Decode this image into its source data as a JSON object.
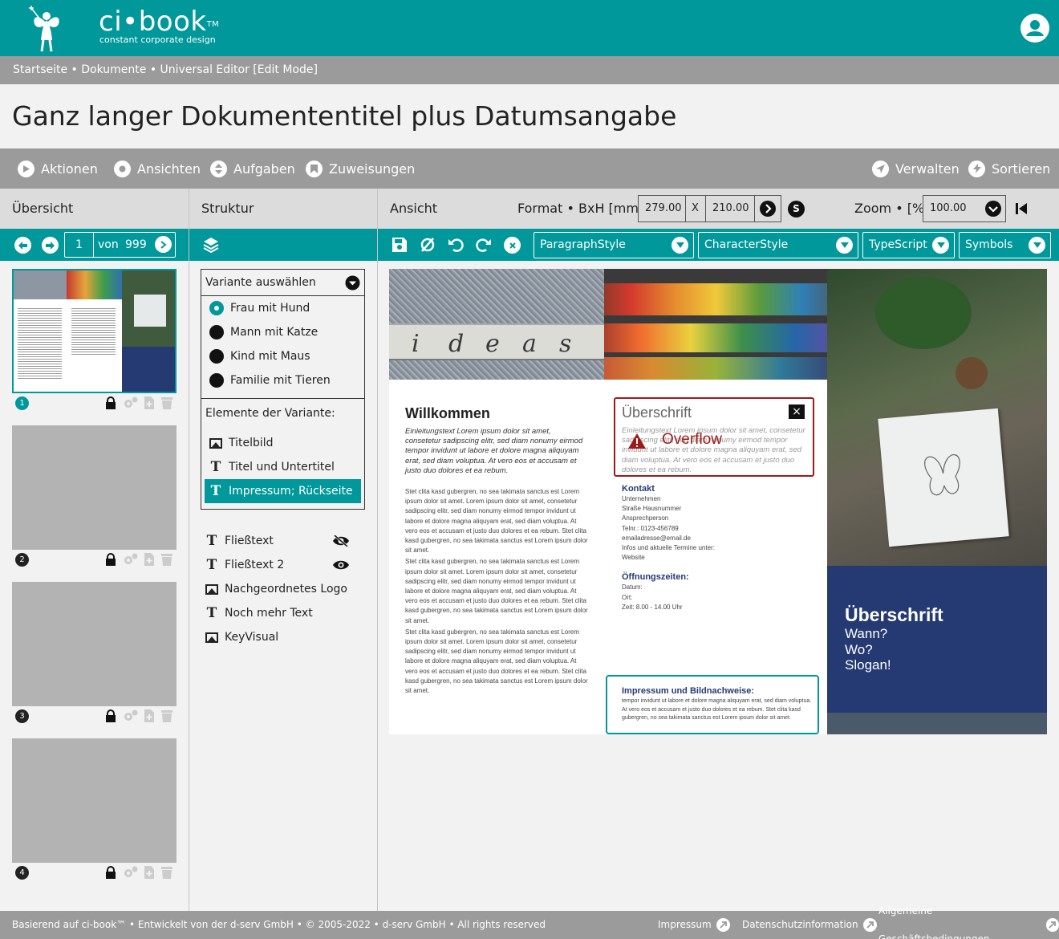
{
  "app": {
    "name": "ci•book",
    "trademark": "TM",
    "tagline": "constant corporate design"
  },
  "breadcrumb": "Startseite • Dokumente • Universal Editor [Edit Mode]",
  "document_title": "Ganz langer Dokumententitel plus Datumsangabe",
  "toolbar": {
    "left": [
      "Aktionen",
      "Ansichten",
      "Aufgaben",
      "Zuweisungen"
    ],
    "right": [
      "Verwalten",
      "Sortieren"
    ]
  },
  "columns": {
    "overview": "Übersicht",
    "structure": "Struktur",
    "view": "Ansicht"
  },
  "format": {
    "label": "Format • BxH [mm]",
    "width": "279.00",
    "separator": "X",
    "height": "210.00",
    "s_button": "S"
  },
  "zoom": {
    "label": "Zoom • [%]",
    "value": "100.00"
  },
  "pager": {
    "current": "1",
    "of_label": "von",
    "total": "999"
  },
  "pages": [
    {
      "number": "1"
    },
    {
      "number": "2"
    },
    {
      "number": "3"
    },
    {
      "number": "4"
    }
  ],
  "style_dropdowns": [
    "ParagraphStyle",
    "CharacterStyle",
    "TypeScript",
    "Symbols"
  ],
  "variants": {
    "select_label": "Variante auswählen",
    "options": [
      "Frau mit Hund",
      "Mann mit Katze",
      "Kind mit Maus",
      "Familie mit Tieren"
    ],
    "selected_index": 0,
    "elements_label": "Elemente der Variante:",
    "elements": [
      {
        "label": "Titelbild",
        "icon": "image-icon"
      },
      {
        "label": "Titel und Untertitel",
        "icon": "text-icon"
      },
      {
        "label": "Impressum; Rückseite",
        "icon": "text-icon"
      }
    ],
    "active_element_index": 2
  },
  "free_elements": [
    {
      "label": "Fließtext",
      "icon": "text-icon",
      "visibility": "eye-slash-icon"
    },
    {
      "label": "Fließtext 2",
      "icon": "text-icon",
      "visibility": "eye-icon"
    },
    {
      "label": "Nachgeordnetes Logo",
      "icon": "image-icon"
    },
    {
      "label": "Noch mehr Text",
      "icon": "text-icon"
    },
    {
      "label": "KeyVisual",
      "icon": "image-icon"
    }
  ],
  "preview": {
    "ideas_letters": [
      "i",
      "d",
      "e",
      "a",
      "s"
    ],
    "welcome_heading": "Willkommen",
    "welcome_intro": "Einleitungstext Lorem ipsum dolor sit amet, consetetur sadipscing elitr, sed diam nonumy eirmod tempor invidunt ut labore et dolore magna aliquyam erat, sed diam voluptua. At vero eos et accusam et justo duo dolores et ea rebum.",
    "body_paragraph": "Stet clita kasd gubergren, no sea takimata sanctus est Lorem ipsum dolor sit amet. Lorem ipsum dolor sit amet, consetetur sadipscing elitr, sed diam nonumy eirmod tempor invidunt ut labore et dolore magna aliquyam erat, sed diam voluptua. At vero eos et accusam et justo duo dolores et ea rebum. Stet clita kasd gubergren, no sea takimata sanctus est Lorem ipsum dolor sit amet.",
    "overflow_box": {
      "heading": "Überschrift",
      "text": "Einleitungstext Lorem ipsum dolor sit amet, consetetur sadipscing elitr, sed diam nonumy eirmod tempor invidunt ut labore et dolore magna aliquyam erat, sed diam voluptua. At vero eos et accusam et justo duo dolores et ea rebum.",
      "warning": "Overflow",
      "close": "×"
    },
    "contact": {
      "heading": "Kontakt",
      "lines": [
        "Unternehmen",
        "Straße Hausnummer",
        "Ansprechperson",
        "Telnr.: 0123-456789",
        "emailadresse@email.de",
        "Infos und aktuelle Termine unter:",
        "Website"
      ]
    },
    "hours": {
      "heading": "Öffnungszeiten:",
      "lines": [
        "Datum:",
        "Ort:",
        "Zeit: 8.00 - 14.00 Uhr"
      ]
    },
    "imprint": {
      "heading": "Impressum und Bildnachweise:",
      "text": "tempor invidunt ut labore et dolore magna aliquyam erat, sed diam voluptua. At vero eos et accusam et justo duo dolores et ea rebum. Stet clita kasd gubergren, no sea takimata sanctus est Lorem ipsum dolor sit amet."
    },
    "back_panel": {
      "heading": "Überschrift",
      "lines": [
        "Wann?",
        "Wo?",
        "Slogan!"
      ]
    }
  },
  "footer": {
    "credit": "Basierend auf ci-book™ • Entwickelt von der d-serv GmbH • © 2005-2022 • d-serv GmbH • All rights reserved",
    "links": [
      "Impressum",
      "Datenschutzinformation",
      "Allgemeine Geschäftsbedingungen"
    ]
  },
  "colors": {
    "brand_teal": "#00989a",
    "gray_bar": "#9b9b9b",
    "navy": "#253a72",
    "warning_red": "#9b1b1b"
  }
}
